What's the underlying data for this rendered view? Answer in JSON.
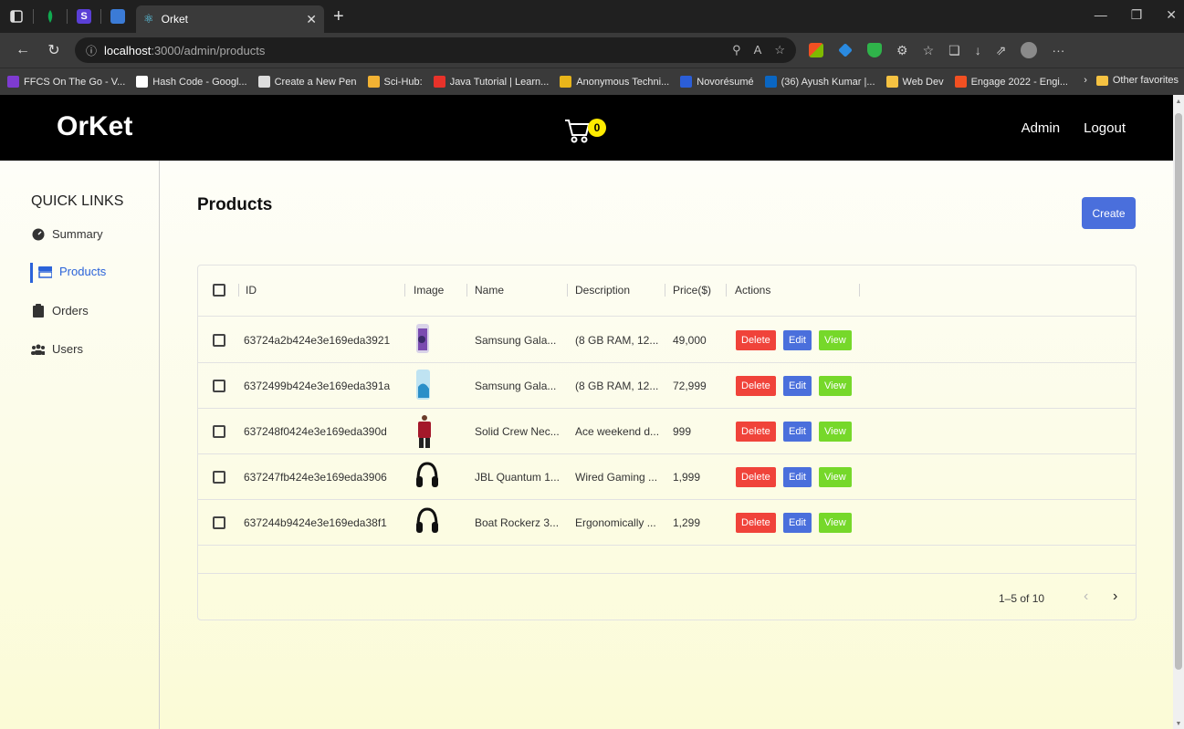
{
  "browser": {
    "tab_title": "Orket",
    "url_host": "localhost",
    "url_path": ":3000/admin/products",
    "bookmarks": [
      {
        "label": "FFCS On The Go - V...",
        "color": "#7e3bd1"
      },
      {
        "label": "Hash Code - Googl...",
        "color": "#ffffff"
      },
      {
        "label": "Create a New Pen",
        "color": "#dddddd"
      },
      {
        "label": "Sci-Hub:",
        "color": "#f2b233"
      },
      {
        "label": "Java Tutorial | Learn...",
        "color": "#e8322a"
      },
      {
        "label": "Anonymous Techni...",
        "color": "#e8b51a"
      },
      {
        "label": "Novorésumé",
        "color": "#2b5ed8"
      },
      {
        "label": "(36) Ayush Kumar |...",
        "color": "#0a66c2"
      },
      {
        "label": "Web Dev",
        "color": "#f5c242"
      },
      {
        "label": "Engage 2022 - Engi...",
        "color": "#f25022"
      }
    ],
    "other_favorites": "Other favorites"
  },
  "header": {
    "brand": "OrKet",
    "cart_count": "0",
    "nav": [
      "Admin",
      "Logout"
    ]
  },
  "sidebar": {
    "title": "QUICK LINKS",
    "items": [
      {
        "label": "Summary",
        "icon": "tachometer-icon"
      },
      {
        "label": "Products",
        "icon": "store-icon",
        "active": true
      },
      {
        "label": "Orders",
        "icon": "clipboard-icon"
      },
      {
        "label": "Users",
        "icon": "users-icon"
      }
    ]
  },
  "page": {
    "title": "Products",
    "create_label": "Create"
  },
  "table": {
    "columns": [
      "ID",
      "Image",
      "Name",
      "Description",
      "Price($)",
      "Actions"
    ],
    "rows": [
      {
        "id": "63724a2b424e3e169eda3921",
        "image": "phone-purple",
        "name": "Samsung Gala...",
        "description": "(8 GB RAM, 12...",
        "price": "49,000"
      },
      {
        "id": "6372499b424e3e169eda391a",
        "image": "phone-blue",
        "name": "Samsung Gala...",
        "description": "(8 GB RAM, 12...",
        "price": "72,999"
      },
      {
        "id": "637248f0424e3e169eda390d",
        "image": "shirt-red",
        "name": "Solid Crew Nec...",
        "description": "Ace weekend d...",
        "price": "999"
      },
      {
        "id": "637247fb424e3e169eda3906",
        "image": "headphones-black",
        "name": "JBL Quantum 1...",
        "description": "Wired Gaming ...",
        "price": "1,999"
      },
      {
        "id": "637244b9424e3e169eda38f1",
        "image": "headphones-black-2",
        "name": "Boat Rockerz 3...",
        "description": "Ergonomically ...",
        "price": "1,299"
      }
    ],
    "action_labels": {
      "delete": "Delete",
      "edit": "Edit",
      "view": "View"
    },
    "pagination": "1–5 of 10"
  },
  "colors": {
    "header_bg": "#000000",
    "accent": "#4a6fdc",
    "delete": "#f0433a",
    "view": "#76d82a",
    "badge": "#ffeb00"
  }
}
